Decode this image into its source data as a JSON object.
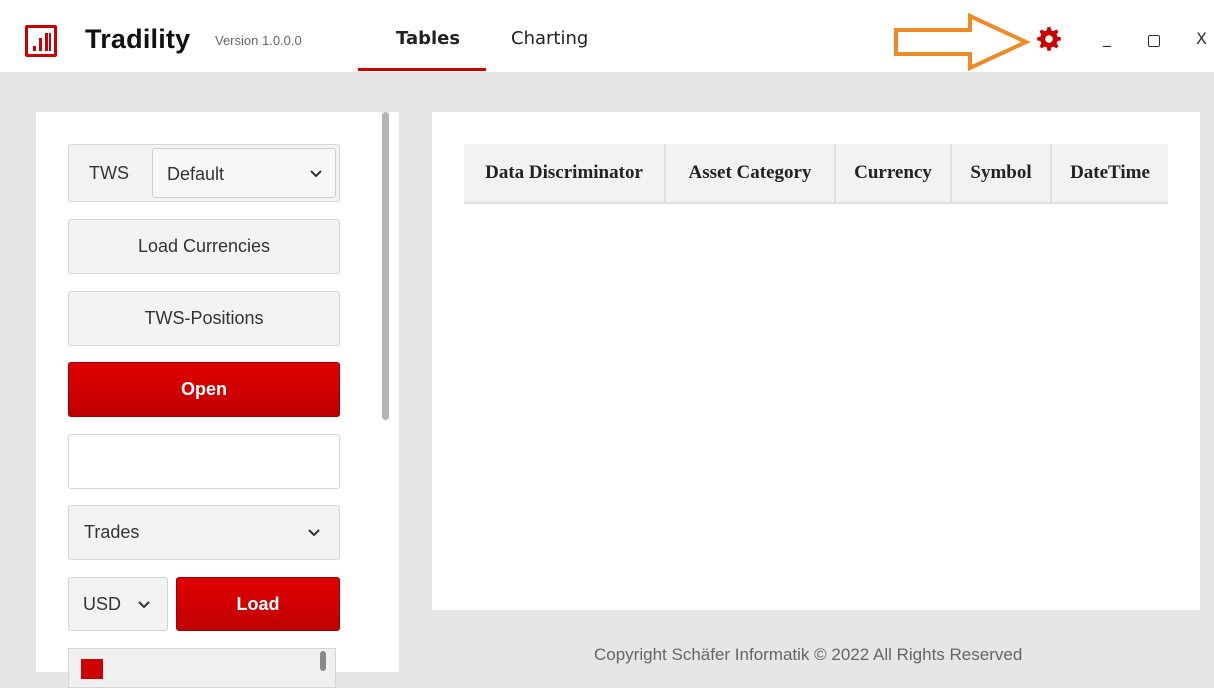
{
  "app": {
    "title": "Tradility",
    "version": "Version 1.0.0.0",
    "brand_color": "#cc0000"
  },
  "tabs": [
    {
      "label": "Tables",
      "active": true
    },
    {
      "label": "Charting",
      "active": false
    }
  ],
  "window_controls": {
    "settings_icon": "gear-icon",
    "minimize": "_",
    "close": "X",
    "annotation_color": "#f08a24"
  },
  "sidebar": {
    "tws_label": "TWS",
    "tws_select_value": "Default",
    "load_currencies": "Load Currencies",
    "tws_positions": "TWS-Positions",
    "open": "Open",
    "text_input_value": "",
    "report_select_value": "Trades",
    "currency_select_value": "USD",
    "load": "Load"
  },
  "table": {
    "columns": [
      "Data Discriminator",
      "Asset Category",
      "Currency",
      "Symbol",
      "DateTime"
    ],
    "rows": []
  },
  "footer": {
    "copyright": "Copyright Schäfer Informatik © 2022 All Rights Reserved"
  }
}
